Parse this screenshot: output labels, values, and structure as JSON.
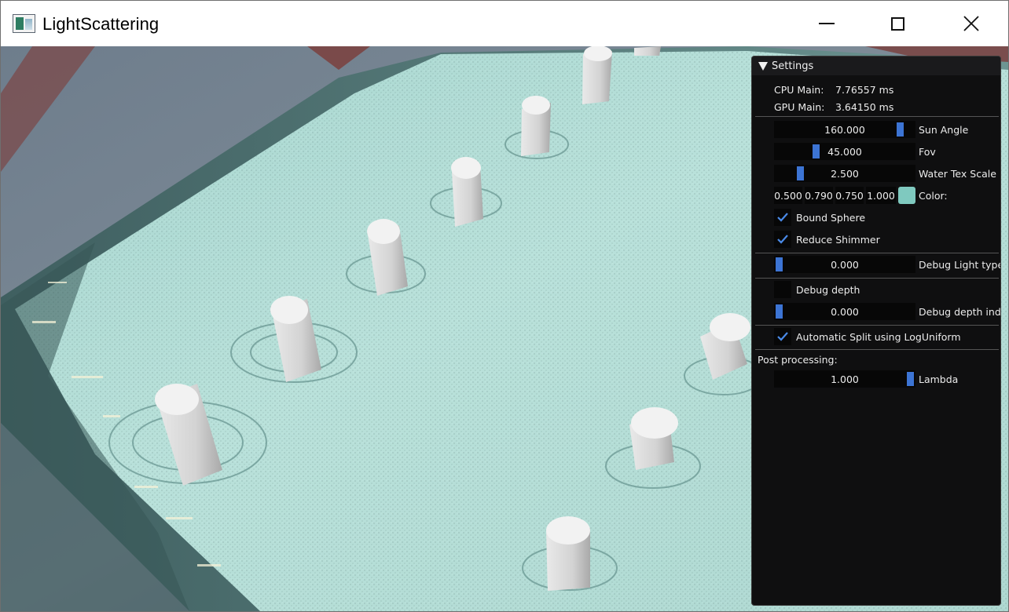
{
  "window": {
    "title": "LightScattering"
  },
  "settings": {
    "header": "Settings",
    "cpu_main_label": "CPU Main:",
    "cpu_main_value": "7.76557 ms",
    "gpu_main_label": "GPU Main:",
    "gpu_main_value": "3.64150 ms",
    "sun_angle": {
      "value": "160.000",
      "label": "Sun Angle",
      "level": 0.92
    },
    "fov": {
      "value": "45.000",
      "label": "Fov",
      "level": 0.28
    },
    "water_tex_scale": {
      "value": "2.500",
      "label": "Water Tex Scale",
      "level": 0.16
    },
    "color": {
      "r": "0.500",
      "g": "0.790",
      "b": "0.750",
      "a": "1.000",
      "label": "Color:",
      "swatch": "#7fc9bf"
    },
    "bound_sphere": {
      "label": "Bound Sphere",
      "checked": true
    },
    "reduce_shimmer": {
      "label": "Reduce Shimmer",
      "checked": true
    },
    "debug_light_type": {
      "value": "0.000",
      "label": "Debug Light type",
      "level": 0.0
    },
    "debug_depth": {
      "label": "Debug depth",
      "checked": false
    },
    "debug_depth_index": {
      "value": "0.000",
      "label": "Debug depth inde",
      "level": 0.0
    },
    "auto_split": {
      "label": "Automatic Split using LogUniform",
      "checked": true
    },
    "post_processing_label": "Post processing:",
    "lambda": {
      "value": "1.000",
      "label": "Lambda",
      "level": 1.0
    }
  },
  "colors": {
    "accent": "#3c74d4",
    "water": "#b8ded8",
    "panel_bg": "#0f0f10"
  }
}
